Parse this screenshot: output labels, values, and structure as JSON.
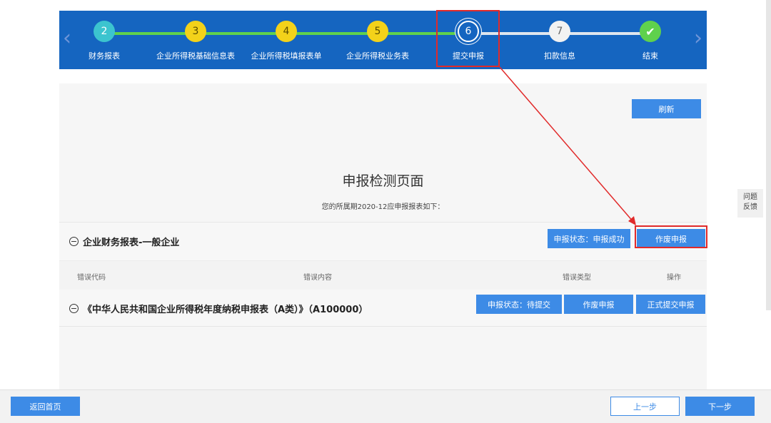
{
  "stepper": {
    "steps": [
      {
        "number": "2",
        "label": "财务报表",
        "state": "teal"
      },
      {
        "number": "3",
        "label": "企业所得税基础信息表",
        "state": "yellow"
      },
      {
        "number": "4",
        "label": "企业所得税填报表单",
        "state": "yellow"
      },
      {
        "number": "5",
        "label": "企业所得税业务表",
        "state": "yellow"
      },
      {
        "number": "6",
        "label": "提交申报",
        "state": "current"
      },
      {
        "number": "7",
        "label": "扣款信息",
        "state": "white"
      },
      {
        "number": "✔",
        "label": "结束",
        "state": "done"
      }
    ],
    "prev_arrow": "‹",
    "next_arrow": "›"
  },
  "main": {
    "refresh_label": "刷新",
    "title": "申报检测页面",
    "subtitle": "您的所属期2020-12应申报报表如下：",
    "section1": {
      "title": "企业财务报表-一般企业",
      "status_label": "申报状态：申报成功",
      "void_label": "作废申报"
    },
    "table_headers": [
      "错误代码",
      "错误内容",
      "错误类型",
      "操作"
    ],
    "section2": {
      "title": "《中华人民共和国企业所得税年度纳税申报表（A类）》（A100000）",
      "status_label": "申报状态：待提交",
      "void_label": "作废申报",
      "submit_label": "正式提交申报"
    }
  },
  "feedback": {
    "line1": "问题",
    "line2": "反馈"
  },
  "footer": {
    "home_label": "返回首页",
    "prev_label": "上一步",
    "next_label": "下一步"
  },
  "colors": {
    "primary": "#1565c0",
    "button": "#3d8be6",
    "annotation": "#e12a2a",
    "progress": "#5fd14c"
  }
}
